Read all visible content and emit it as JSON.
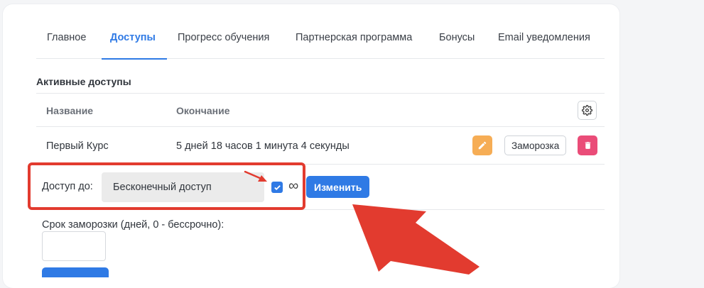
{
  "tabs": [
    {
      "label": "Главное"
    },
    {
      "label": "Доступы",
      "active": true
    },
    {
      "label": "Прогресс обучения"
    },
    {
      "label": "Партнерская программа"
    },
    {
      "label": "Бонусы"
    },
    {
      "label": "Email уведомления"
    }
  ],
  "section_title": "Активные доступы",
  "table": {
    "columns": [
      "Название",
      "Окончание"
    ],
    "rows": [
      {
        "name": "Первый Курс",
        "end": "5 дней 18 часов 1 минута 4 секунды"
      }
    ],
    "freeze_button": "Заморозка"
  },
  "access": {
    "label": "Доступ до:",
    "value": "Бесконечный доступ",
    "infinite_checked": true,
    "infinity_symbol": "∞",
    "change_button": "Изменить"
  },
  "freeze": {
    "label": "Срок заморозки (дней, 0 - бессрочно):",
    "value": ""
  },
  "colors": {
    "accent": "#2f7ae5",
    "edit": "#f6ad55",
    "delete": "#ea4c78",
    "annotation": "#e23b2f"
  },
  "icons": [
    "gear-icon",
    "pencil-icon",
    "trash-icon",
    "check-icon"
  ]
}
